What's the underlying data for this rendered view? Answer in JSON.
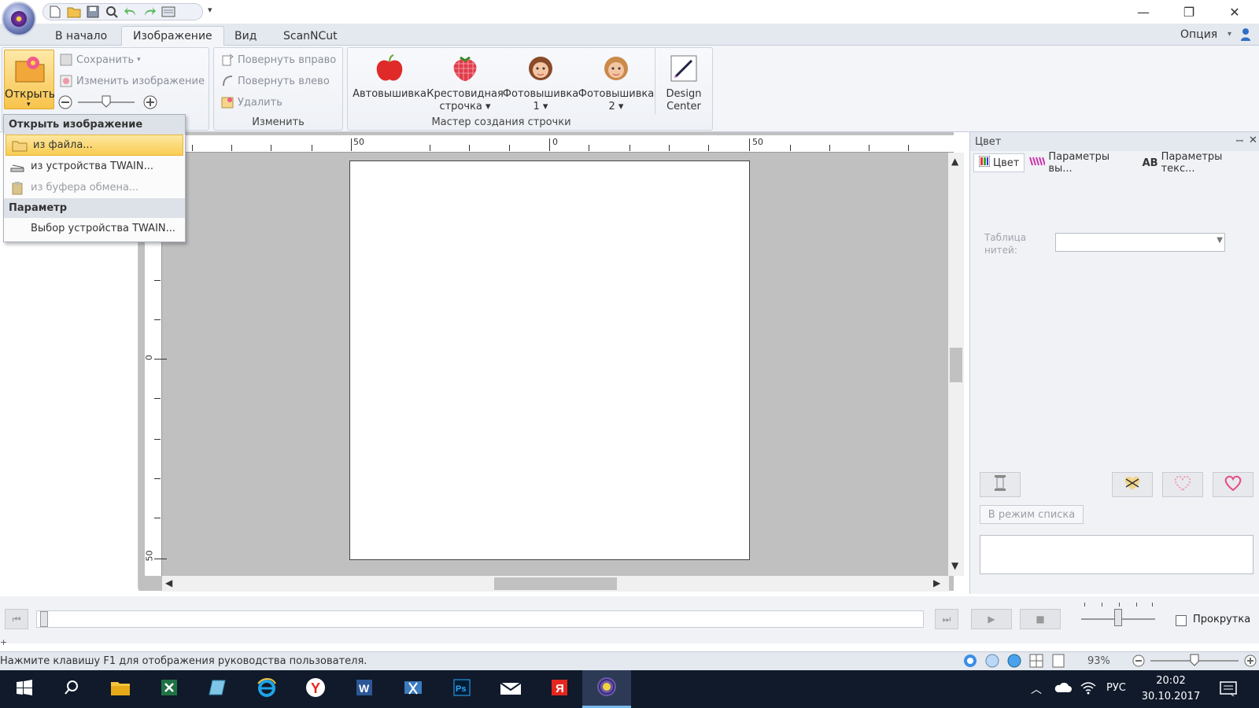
{
  "window": {
    "minimize": "—",
    "restore": "❐",
    "close": "✕"
  },
  "tabs": [
    "В начало",
    "Изображение",
    "Вид",
    "ScanNCut"
  ],
  "options_label": "Опция",
  "ribbon": {
    "open_label": "Открыть",
    "save_label": "Сохранить",
    "edit_image_label": "Изменить изображение",
    "rotate_right_label": "Повернуть вправо",
    "rotate_left_label": "Повернуть влево",
    "delete_label": "Удалить",
    "group_edit_label": "Изменить",
    "auto_label": "Автовышивка",
    "cross_label_1": "Крестовидная",
    "cross_label_2": "строчка",
    "photo1_label_1": "Фотовышивка",
    "photo1_label_2": "1",
    "photo2_label_1": "Фотовышивка",
    "photo2_label_2": "2",
    "design_label_1": "Design",
    "design_label_2": "Center",
    "group_wizard_label": "Мастер создания строчки"
  },
  "menu": {
    "header_open": "Открыть изображение",
    "from_file": "из файла...",
    "from_twain": "из устройства TWAIN...",
    "from_clipboard": "из буфера обмена...",
    "header_param": "Параметр",
    "twain_select": "Выбор устройства TWAIN..."
  },
  "ruler": {
    "h_left": "50",
    "h_center": "0",
    "h_right": "50",
    "v_mid": "0",
    "v_bottom": "50"
  },
  "right_panel": {
    "title": "Цвет",
    "tab_color": "Цвет",
    "tab_stitch": "Параметры вы...",
    "tab_text": "Параметры текс...",
    "thread_label": "Таблица нитей:",
    "list_mode_button": "В режим списка"
  },
  "playbar": {
    "scroll_label": "Прокрутка"
  },
  "status": {
    "message": "Нажмите клавишу F1 для отображения руководства пользователя.",
    "zoom": "93%"
  },
  "taskbar": {
    "lang": "РУС",
    "time": "20:02",
    "date": "30.10.2017"
  }
}
